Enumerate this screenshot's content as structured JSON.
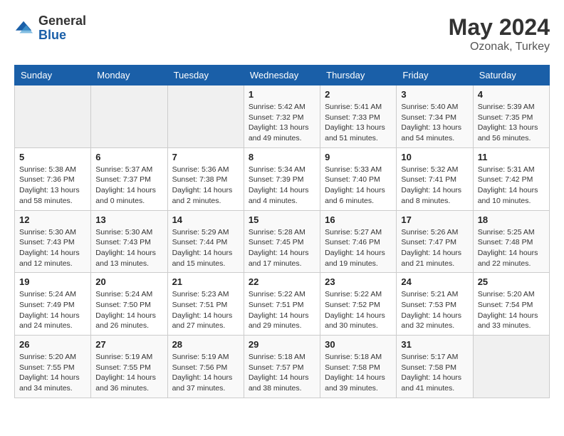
{
  "header": {
    "logo_general": "General",
    "logo_blue": "Blue",
    "month_year": "May 2024",
    "location": "Ozonak, Turkey"
  },
  "weekdays": [
    "Sunday",
    "Monday",
    "Tuesday",
    "Wednesday",
    "Thursday",
    "Friday",
    "Saturday"
  ],
  "weeks": [
    [
      {
        "day": "",
        "sunrise": "",
        "sunset": "",
        "daylight": ""
      },
      {
        "day": "",
        "sunrise": "",
        "sunset": "",
        "daylight": ""
      },
      {
        "day": "",
        "sunrise": "",
        "sunset": "",
        "daylight": ""
      },
      {
        "day": "1",
        "sunrise": "Sunrise: 5:42 AM",
        "sunset": "Sunset: 7:32 PM",
        "daylight": "Daylight: 13 hours and 49 minutes."
      },
      {
        "day": "2",
        "sunrise": "Sunrise: 5:41 AM",
        "sunset": "Sunset: 7:33 PM",
        "daylight": "Daylight: 13 hours and 51 minutes."
      },
      {
        "day": "3",
        "sunrise": "Sunrise: 5:40 AM",
        "sunset": "Sunset: 7:34 PM",
        "daylight": "Daylight: 13 hours and 54 minutes."
      },
      {
        "day": "4",
        "sunrise": "Sunrise: 5:39 AM",
        "sunset": "Sunset: 7:35 PM",
        "daylight": "Daylight: 13 hours and 56 minutes."
      }
    ],
    [
      {
        "day": "5",
        "sunrise": "Sunrise: 5:38 AM",
        "sunset": "Sunset: 7:36 PM",
        "daylight": "Daylight: 13 hours and 58 minutes."
      },
      {
        "day": "6",
        "sunrise": "Sunrise: 5:37 AM",
        "sunset": "Sunset: 7:37 PM",
        "daylight": "Daylight: 14 hours and 0 minutes."
      },
      {
        "day": "7",
        "sunrise": "Sunrise: 5:36 AM",
        "sunset": "Sunset: 7:38 PM",
        "daylight": "Daylight: 14 hours and 2 minutes."
      },
      {
        "day": "8",
        "sunrise": "Sunrise: 5:34 AM",
        "sunset": "Sunset: 7:39 PM",
        "daylight": "Daylight: 14 hours and 4 minutes."
      },
      {
        "day": "9",
        "sunrise": "Sunrise: 5:33 AM",
        "sunset": "Sunset: 7:40 PM",
        "daylight": "Daylight: 14 hours and 6 minutes."
      },
      {
        "day": "10",
        "sunrise": "Sunrise: 5:32 AM",
        "sunset": "Sunset: 7:41 PM",
        "daylight": "Daylight: 14 hours and 8 minutes."
      },
      {
        "day": "11",
        "sunrise": "Sunrise: 5:31 AM",
        "sunset": "Sunset: 7:42 PM",
        "daylight": "Daylight: 14 hours and 10 minutes."
      }
    ],
    [
      {
        "day": "12",
        "sunrise": "Sunrise: 5:30 AM",
        "sunset": "Sunset: 7:43 PM",
        "daylight": "Daylight: 14 hours and 12 minutes."
      },
      {
        "day": "13",
        "sunrise": "Sunrise: 5:30 AM",
        "sunset": "Sunset: 7:43 PM",
        "daylight": "Daylight: 14 hours and 13 minutes."
      },
      {
        "day": "14",
        "sunrise": "Sunrise: 5:29 AM",
        "sunset": "Sunset: 7:44 PM",
        "daylight": "Daylight: 14 hours and 15 minutes."
      },
      {
        "day": "15",
        "sunrise": "Sunrise: 5:28 AM",
        "sunset": "Sunset: 7:45 PM",
        "daylight": "Daylight: 14 hours and 17 minutes."
      },
      {
        "day": "16",
        "sunrise": "Sunrise: 5:27 AM",
        "sunset": "Sunset: 7:46 PM",
        "daylight": "Daylight: 14 hours and 19 minutes."
      },
      {
        "day": "17",
        "sunrise": "Sunrise: 5:26 AM",
        "sunset": "Sunset: 7:47 PM",
        "daylight": "Daylight: 14 hours and 21 minutes."
      },
      {
        "day": "18",
        "sunrise": "Sunrise: 5:25 AM",
        "sunset": "Sunset: 7:48 PM",
        "daylight": "Daylight: 14 hours and 22 minutes."
      }
    ],
    [
      {
        "day": "19",
        "sunrise": "Sunrise: 5:24 AM",
        "sunset": "Sunset: 7:49 PM",
        "daylight": "Daylight: 14 hours and 24 minutes."
      },
      {
        "day": "20",
        "sunrise": "Sunrise: 5:24 AM",
        "sunset": "Sunset: 7:50 PM",
        "daylight": "Daylight: 14 hours and 26 minutes."
      },
      {
        "day": "21",
        "sunrise": "Sunrise: 5:23 AM",
        "sunset": "Sunset: 7:51 PM",
        "daylight": "Daylight: 14 hours and 27 minutes."
      },
      {
        "day": "22",
        "sunrise": "Sunrise: 5:22 AM",
        "sunset": "Sunset: 7:51 PM",
        "daylight": "Daylight: 14 hours and 29 minutes."
      },
      {
        "day": "23",
        "sunrise": "Sunrise: 5:22 AM",
        "sunset": "Sunset: 7:52 PM",
        "daylight": "Daylight: 14 hours and 30 minutes."
      },
      {
        "day": "24",
        "sunrise": "Sunrise: 5:21 AM",
        "sunset": "Sunset: 7:53 PM",
        "daylight": "Daylight: 14 hours and 32 minutes."
      },
      {
        "day": "25",
        "sunrise": "Sunrise: 5:20 AM",
        "sunset": "Sunset: 7:54 PM",
        "daylight": "Daylight: 14 hours and 33 minutes."
      }
    ],
    [
      {
        "day": "26",
        "sunrise": "Sunrise: 5:20 AM",
        "sunset": "Sunset: 7:55 PM",
        "daylight": "Daylight: 14 hours and 34 minutes."
      },
      {
        "day": "27",
        "sunrise": "Sunrise: 5:19 AM",
        "sunset": "Sunset: 7:55 PM",
        "daylight": "Daylight: 14 hours and 36 minutes."
      },
      {
        "day": "28",
        "sunrise": "Sunrise: 5:19 AM",
        "sunset": "Sunset: 7:56 PM",
        "daylight": "Daylight: 14 hours and 37 minutes."
      },
      {
        "day": "29",
        "sunrise": "Sunrise: 5:18 AM",
        "sunset": "Sunset: 7:57 PM",
        "daylight": "Daylight: 14 hours and 38 minutes."
      },
      {
        "day": "30",
        "sunrise": "Sunrise: 5:18 AM",
        "sunset": "Sunset: 7:58 PM",
        "daylight": "Daylight: 14 hours and 39 minutes."
      },
      {
        "day": "31",
        "sunrise": "Sunrise: 5:17 AM",
        "sunset": "Sunset: 7:58 PM",
        "daylight": "Daylight: 14 hours and 41 minutes."
      },
      {
        "day": "",
        "sunrise": "",
        "sunset": "",
        "daylight": ""
      }
    ]
  ]
}
